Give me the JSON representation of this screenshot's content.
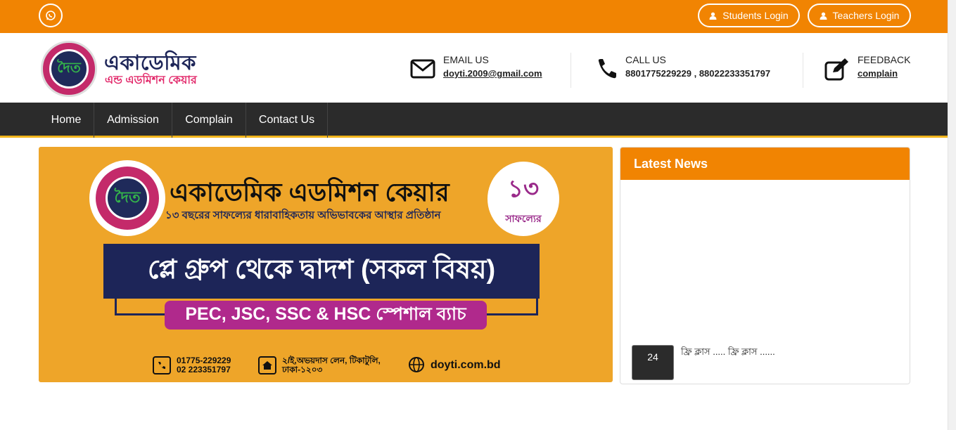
{
  "topbar": {
    "whatsapp_icon": "whatsapp-icon",
    "students_login": "Students Login",
    "teachers_login": "Teachers Login",
    "color": "#f18402"
  },
  "header": {
    "brand_line1": "একাডেমিক",
    "brand_line2": "এন্ড এডমিশন কেয়ার",
    "logo_glyph": "দৈত",
    "email_label": "EMAIL US",
    "email_value": "doyti.2009@gmail.com",
    "call_label": "CALL US",
    "call_value": "8801775229229 , 88022233351797",
    "feedback_label": "FEEDBACK",
    "feedback_value": "complain"
  },
  "nav": {
    "items": [
      {
        "label": "Home"
      },
      {
        "label": "Admission"
      },
      {
        "label": "Complain"
      },
      {
        "label": "Contact Us"
      }
    ]
  },
  "banner": {
    "title": "একাডেমিক এডমিশন কেয়ার",
    "subtitle": "১৩ বছরের সাফল্যের ধারাবাহিকতায় অভিভাবকের আস্থার প্রতিষ্ঠান",
    "badge_number": "১৩",
    "badge_text": "সাফল্যের",
    "headline": "প্লে গ্রুপ থেকে দ্বাদশ (সকল বিষয়)",
    "pill": "PEC, JSC, SSC & HSC স্পেশাল ব্যাচ",
    "phone1": "01775-229229",
    "phone2": "02 223351797",
    "address1": "২/ই,অভয়দাস লেন, টিকাটুলি,",
    "address2": "ঢাকা-১২০৩",
    "website": "doyti.com.bd"
  },
  "news": {
    "heading": "Latest News",
    "items": [
      {
        "date": "24",
        "text": "ফ্রি ক্লাস ..... ফ্রি ক্লাস ......"
      }
    ]
  }
}
